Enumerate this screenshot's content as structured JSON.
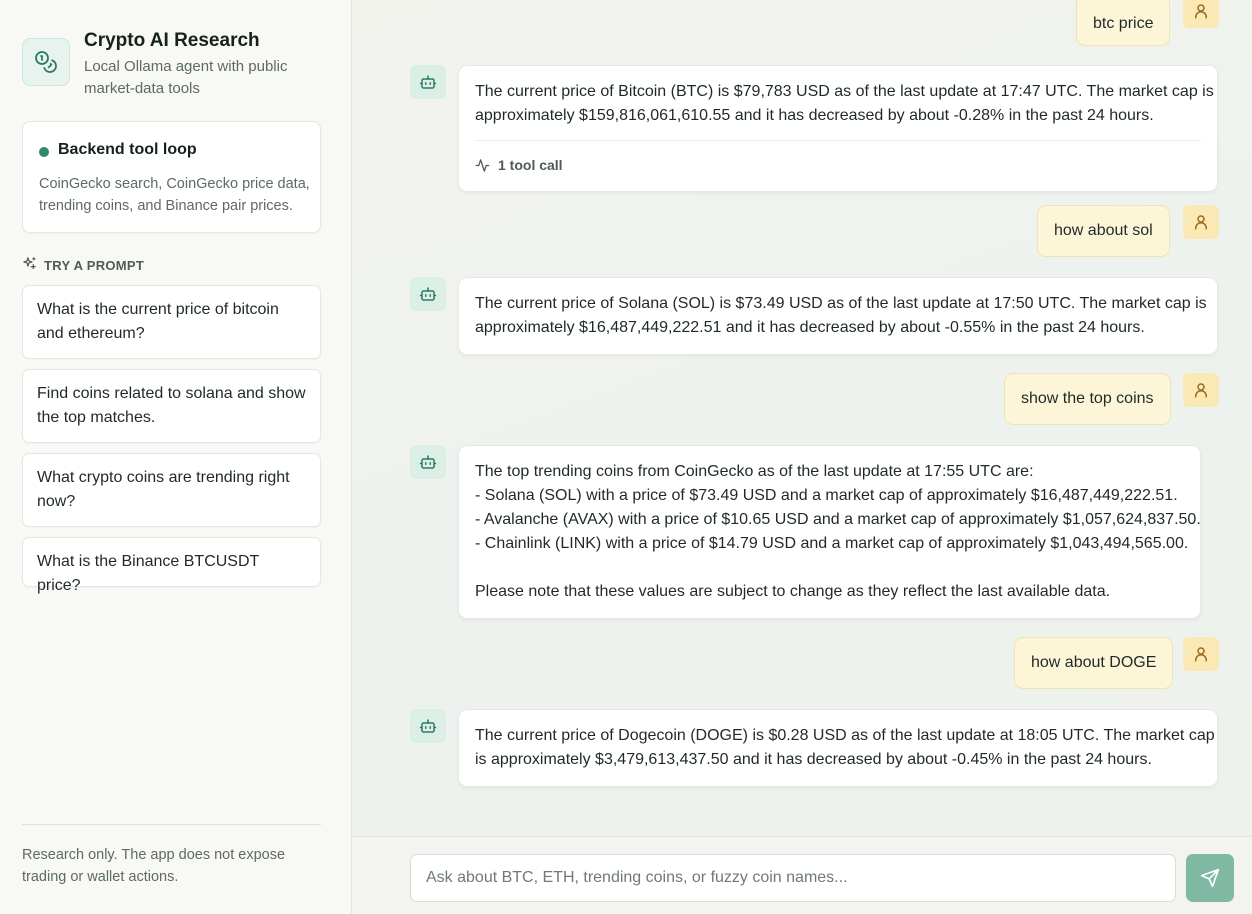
{
  "sidebar": {
    "title": "Crypto AI Research",
    "subtitle": "Local Ollama agent with public market-data tools",
    "backend": {
      "title": "Backend tool loop",
      "description": "CoinGecko search, CoinGecko price data, trending coins, and Binance pair prices."
    },
    "try_label": "TRY A PROMPT",
    "prompts": [
      {
        "label": "What is the current price of bitcoin and ethereum?"
      },
      {
        "label": "Find coins related to solana and show the top matches."
      },
      {
        "label": "What crypto coins are trending right now?"
      },
      {
        "label": "What is the Binance BTCUSDT price?"
      }
    ],
    "footnote": "Research only. The app does not expose trading or wallet actions."
  },
  "chat": {
    "messages": [
      {
        "role": "user",
        "text": "btc price"
      },
      {
        "role": "assistant",
        "lines": [
          "The current price of Bitcoin (BTC) is $79,783 USD as of the last update at 17:47 UTC. The market cap is",
          "approximately $159,816,061,610.55 and it has decreased by about -0.28% in the past 24 hours."
        ],
        "tool_calls": "1 tool call"
      },
      {
        "role": "user",
        "text": "how about sol"
      },
      {
        "role": "assistant",
        "lines": [
          "The current price of Solana (SOL) is $73.49 USD as of the last update at 17:50 UTC. The market cap is",
          "approximately $16,487,449,222.51 and it has decreased by about -0.55% in the past 24 hours."
        ]
      },
      {
        "role": "user",
        "text": "show the top coins"
      },
      {
        "role": "assistant",
        "lines": [
          "The top trending coins from CoinGecko as of the last update at 17:55 UTC are:",
          "- Solana (SOL) with a price of $73.49 USD and a market cap of approximately $16,487,449,222.51.",
          "- Avalanche (AVAX) with a price of $10.65 USD and a market cap of approximately $1,057,624,837.50.",
          "- Chainlink (LINK) with a price of $14.79 USD and a market cap of approximately $1,043,494,565.00.",
          "",
          "Please note that these values are subject to change as they reflect the last available data."
        ]
      },
      {
        "role": "user",
        "text": "how about DOGE"
      },
      {
        "role": "assistant",
        "lines": [
          "The current price of Dogecoin (DOGE) is $0.28 USD as of the last update at 18:05 UTC. The market cap",
          "is approximately $3,479,613,437.50 and it has decreased by about -0.45% in the past 24 hours."
        ]
      }
    ]
  },
  "composer": {
    "placeholder": "Ask about BTC, ETH, trending coins, or fuzzy coin names...",
    "value": ""
  },
  "colors": {
    "accent": "#2f8a6b",
    "send_button": "#7fb8a3",
    "user_bubble": "#fdf5d8",
    "user_avatar": "#fbe9b5",
    "bot_avatar": "#dcefe6"
  },
  "icons": {
    "brand": "coins-icon",
    "try": "sparkle-icon",
    "bot": "bot-icon",
    "user": "user-icon",
    "tool": "activity-icon",
    "send": "send-icon"
  }
}
